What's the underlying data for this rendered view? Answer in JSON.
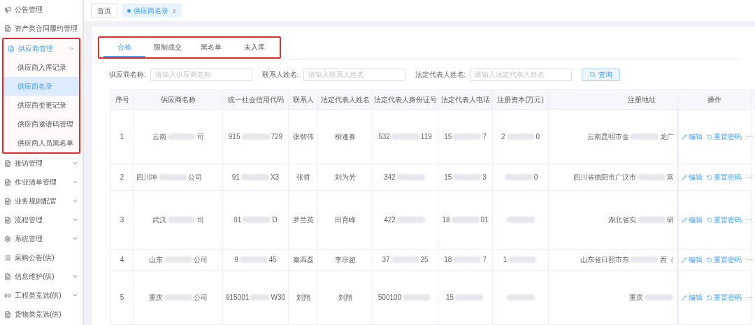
{
  "sidebar": {
    "items": [
      {
        "label": "公告管理",
        "kind": "link",
        "annotated": false
      },
      {
        "label": "资产类合同履约管理",
        "kind": "link",
        "annotated": false
      },
      {
        "label": "供应商管理",
        "kind": "group",
        "expanded": true,
        "annotated": true,
        "children": [
          {
            "label": "供应商入库记录",
            "selected": false
          },
          {
            "label": "供应商名录",
            "selected": true
          },
          {
            "label": "供应商变更记录",
            "selected": false
          },
          {
            "label": "供应商邀请码管理",
            "selected": false
          },
          {
            "label": "供应商人员黑名单",
            "selected": false
          }
        ]
      },
      {
        "label": "接访管理",
        "kind": "group",
        "expanded": false,
        "annotated": false
      },
      {
        "label": "作业清单管理",
        "kind": "group",
        "expanded": false,
        "annotated": false
      },
      {
        "label": "业务规则配置",
        "kind": "group",
        "expanded": false,
        "annotated": false
      },
      {
        "label": "流程管理",
        "kind": "group",
        "expanded": false,
        "annotated": false
      },
      {
        "label": "系统管理",
        "kind": "group",
        "expanded": false,
        "annotated": false
      },
      {
        "label": "采购公告(供)",
        "kind": "link",
        "annotated": false
      },
      {
        "label": "信息维护(供)",
        "kind": "group",
        "expanded": false,
        "annotated": false
      },
      {
        "label": "工程类竞选(供)",
        "kind": "group",
        "expanded": false,
        "annotated": false
      },
      {
        "label": "货物类竞选(供)",
        "kind": "link",
        "annotated": false
      }
    ]
  },
  "page_tabs": [
    {
      "label": "首页",
      "selected": false
    },
    {
      "label": "供应商名录",
      "selected": true,
      "close": "x"
    }
  ],
  "status_tabs": {
    "annotated": true,
    "items": [
      {
        "label": "合格",
        "selected": true
      },
      {
        "label": "限制成交",
        "selected": false
      },
      {
        "label": "黑名单",
        "selected": false
      },
      {
        "label": "未入库",
        "selected": false
      }
    ]
  },
  "filters": [
    {
      "label": "供应商名称:",
      "placeholder": "请输入供应商名称"
    },
    {
      "label": "联系人姓名:",
      "placeholder": "请输入联系人姓名"
    },
    {
      "label": "法定代表人姓名:",
      "placeholder": "请输入法定代表人姓名"
    }
  ],
  "search_button": "查询",
  "table": {
    "columns": [
      "序号",
      "供应商名称",
      "统一社会信用代码",
      "联系人",
      "法定代表人姓名",
      "法定代表人身份证号",
      "法定代表人电话",
      "注册资本(万元)",
      "注册地址",
      "操作"
    ],
    "rows": [
      {
        "cells": [
          {
            "kind": "plain",
            "text": "1"
          },
          {
            "kind": "masked",
            "start": "云南",
            "end": "司"
          },
          {
            "kind": "masked",
            "start": "915",
            "end": "729"
          },
          {
            "kind": "plain",
            "text": "张智伟"
          },
          {
            "kind": "plain",
            "text": "柳逢春"
          },
          {
            "kind": "masked",
            "start": "532",
            "end": "119"
          },
          {
            "kind": "masked",
            "start": "15",
            "end": "7"
          },
          {
            "kind": "masked",
            "start": "2",
            "end": "0"
          },
          {
            "kind": "masked",
            "start": "云南昆明市金",
            "end": "龙广"
          }
        ],
        "actions": [
          "编辑",
          "重置密码",
          "⋯"
        ]
      },
      {
        "cells": [
          {
            "kind": "plain",
            "text": "2"
          },
          {
            "kind": "masked",
            "start": "四川坤",
            "end": "公司"
          },
          {
            "kind": "masked",
            "start": "91",
            "end": "X3"
          },
          {
            "kind": "plain",
            "text": "张哲"
          },
          {
            "kind": "plain",
            "text": "刘为芳"
          },
          {
            "kind": "masked",
            "start": "342"
          },
          {
            "kind": "masked",
            "start": "15",
            "end": "3"
          },
          {
            "kind": "masked",
            "end": "0"
          },
          {
            "kind": "masked",
            "start": "四川省德阳市广汉市",
            "end": "富"
          }
        ],
        "actions": [
          "编辑",
          "重置密码",
          "⋯"
        ]
      },
      {
        "cells": [
          {
            "kind": "plain",
            "text": "3"
          },
          {
            "kind": "masked",
            "start": "武汉",
            "end": "司"
          },
          {
            "kind": "masked",
            "start": "91",
            "end": "D"
          },
          {
            "kind": "plain",
            "text": "罗兰英"
          },
          {
            "kind": "plain",
            "text": "田育峰"
          },
          {
            "kind": "masked",
            "start": "422"
          },
          {
            "kind": "masked",
            "start": "18",
            "end": "01"
          },
          {
            "kind": "masked"
          },
          {
            "kind": "masked",
            "start": "湖北省实",
            "end": "研"
          }
        ],
        "actions": [
          "编辑",
          "重置密码",
          "⋯"
        ]
      },
      {
        "cells": [
          {
            "kind": "plain",
            "text": "4"
          },
          {
            "kind": "masked",
            "start": "山东",
            "end": "公司"
          },
          {
            "kind": "masked",
            "start": "9",
            "end": "45"
          },
          {
            "kind": "plain",
            "text": "秦四磊"
          },
          {
            "kind": "plain",
            "text": "李宗超"
          },
          {
            "kind": "masked",
            "start": "37",
            "end": "25"
          },
          {
            "kind": "masked",
            "start": "18",
            "end": "7"
          },
          {
            "kind": "masked",
            "start": "1"
          },
          {
            "kind": "masked",
            "start": "山东省日照市东",
            "end": "西（"
          }
        ],
        "actions": [
          "编辑",
          "重置密码",
          "⋯"
        ]
      },
      {
        "cells": [
          {
            "kind": "plain",
            "text": "5"
          },
          {
            "kind": "masked",
            "start": "重庆",
            "end": "公司"
          },
          {
            "kind": "masked",
            "start": "915001",
            "end": "W30"
          },
          {
            "kind": "plain",
            "text": "刘翔"
          },
          {
            "kind": "plain",
            "text": "刘翔"
          },
          {
            "kind": "masked",
            "start": "500100"
          },
          {
            "kind": "masked",
            "start": "15"
          },
          {
            "kind": "masked"
          },
          {
            "kind": "masked",
            "start": "重庆"
          }
        ],
        "actions": [
          "编辑",
          "重置密码",
          "⋯"
        ]
      }
    ]
  }
}
